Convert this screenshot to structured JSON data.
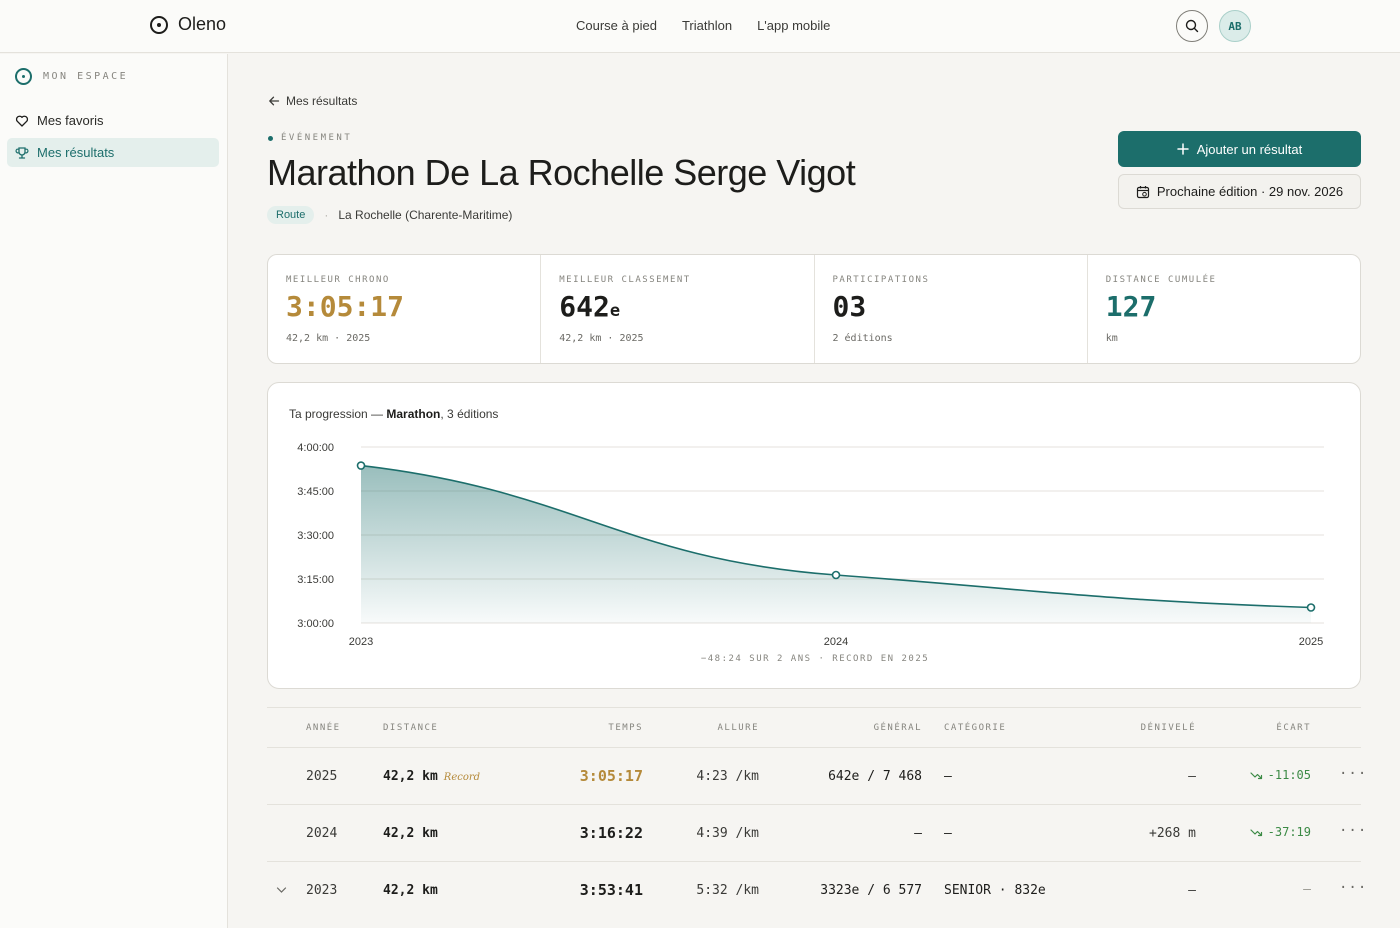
{
  "header": {
    "brand": "Oleno",
    "nav": [
      "Course à pied",
      "Triathlon",
      "L'app mobile"
    ],
    "avatar_initials": "AB"
  },
  "sidebar": {
    "title": "MON ESPACE",
    "items": [
      {
        "label": "Mes favoris",
        "icon": "heart-icon",
        "active": false
      },
      {
        "label": "Mes résultats",
        "icon": "trophy-icon",
        "active": true
      }
    ]
  },
  "page": {
    "back_label": "Mes résultats",
    "eyebrow": "ÉVÉNEMENT",
    "title": "Marathon De La Rochelle Serge Vigot",
    "tag": "Route",
    "separator": "·",
    "location": "La Rochelle (Charente-Maritime)",
    "add_result_label": "Ajouter un résultat",
    "next_edition_label": "Prochaine édition · 29 nov. 2026"
  },
  "stats": [
    {
      "label": "MEILLEUR CHRONO",
      "value": "3:05:17",
      "suffix": "",
      "sub": "42,2 km · 2025",
      "color": "#b58a3a"
    },
    {
      "label": "MEILLEUR CLASSEMENT",
      "value": "642",
      "suffix": "e",
      "sub": "42,2 km · 2025",
      "color": "#1d1d1b"
    },
    {
      "label": "PARTICIPATIONS",
      "value": "03",
      "suffix": "",
      "sub": "2 éditions",
      "color": "#1d1d1b"
    },
    {
      "label": "DISTANCE CUMULÉE",
      "value": "127",
      "suffix": "",
      "sub": "km",
      "color": "#1c6e6b"
    }
  ],
  "chart_caption": {
    "prefix": "Ta progression — ",
    "strong": "Marathon",
    "suffix": ", 3 éditions"
  },
  "chart_data": {
    "type": "area",
    "x": [
      "2023",
      "2024",
      "2025"
    ],
    "series": [
      {
        "values": [
          "3:53:41",
          "3:16:22",
          "3:05:17"
        ],
        "seconds": [
          14021,
          11782,
          11117
        ]
      }
    ],
    "yticks": [
      "4:00:00",
      "3:45:00",
      "3:30:00",
      "3:15:00",
      "3:00:00"
    ],
    "ylim": [
      10800,
      14400
    ],
    "grid": true,
    "color": "#1c6e6b",
    "footnote": "−48:24 SUR 2 ANS · RECORD EN 2025"
  },
  "table": {
    "headers": [
      "ANNÉE",
      "DISTANCE",
      "TEMPS",
      "ALLURE",
      "GÉNÉRAL",
      "CATÉGORIE",
      "DÉNIVELÉ",
      "ÉCART"
    ],
    "rows": [
      {
        "year": "2025",
        "distance": "42,2 km",
        "record": "Record",
        "time": "3:05:17",
        "pace": "4:23 /km",
        "overall": "642e / 7 468",
        "category": "–",
        "elevation": "–",
        "gap": "-11:05",
        "gap_arrow": true,
        "expand": false
      },
      {
        "year": "2024",
        "distance": "42,2 km",
        "record": "",
        "time": "3:16:22",
        "pace": "4:39 /km",
        "overall": "–",
        "category": "–",
        "elevation": "+268 m",
        "gap": "-37:19",
        "gap_arrow": true,
        "expand": false
      },
      {
        "year": "2023",
        "distance": "42,2 km",
        "record": "",
        "time": "3:53:41",
        "pace": "5:32 /km",
        "overall": "3323e / 6 577",
        "category": "SENIOR · 832e",
        "elevation": "–",
        "gap": "–",
        "gap_arrow": false,
        "expand": true
      }
    ]
  }
}
